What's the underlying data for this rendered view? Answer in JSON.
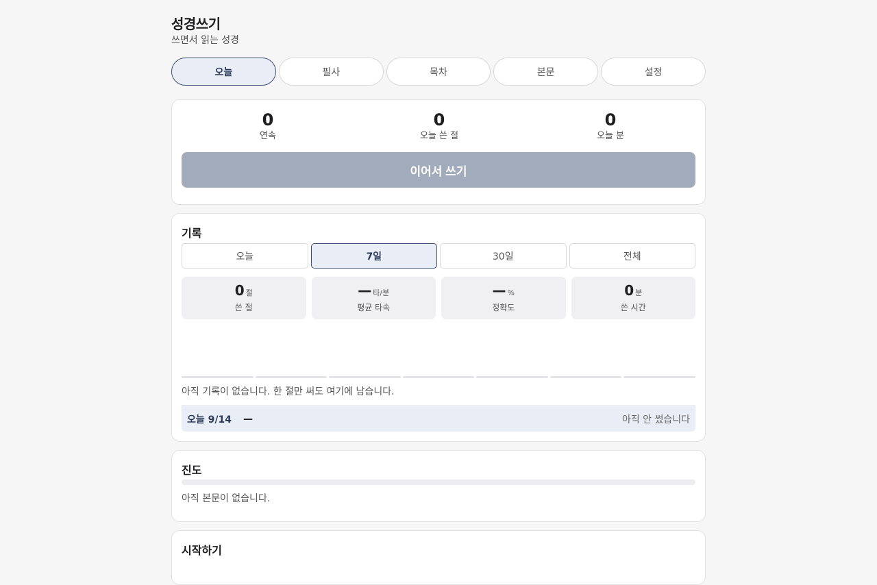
{
  "header": {
    "title": "성경쓰기",
    "subtitle": "쓰면서 읽는 성경"
  },
  "tabs": [
    {
      "label": "오늘",
      "active": true
    },
    {
      "label": "필사",
      "active": false
    },
    {
      "label": "목차",
      "active": false
    },
    {
      "label": "본문",
      "active": false
    },
    {
      "label": "설정",
      "active": false
    }
  ],
  "today": {
    "stats": [
      {
        "value": "0",
        "label": "연속"
      },
      {
        "value": "0",
        "label": "오늘 쓴 절"
      },
      {
        "value": "0",
        "label": "오늘 분"
      }
    ],
    "continue_label": "이어서 쓰기"
  },
  "history": {
    "title": "기록",
    "ranges": [
      {
        "label": "오늘",
        "active": false
      },
      {
        "label": "7일",
        "active": true
      },
      {
        "label": "30일",
        "active": false
      },
      {
        "label": "전체",
        "active": false
      }
    ],
    "metrics": [
      {
        "value": "0",
        "unit": "절",
        "label": "쓴 절"
      },
      {
        "value": "—",
        "unit": "타/분",
        "label": "평균 타속"
      },
      {
        "value": "—",
        "unit": "%",
        "label": "정확도"
      },
      {
        "value": "0",
        "unit": "분",
        "label": "쓴 시간"
      }
    ],
    "daily_values": [
      0,
      0,
      0,
      0,
      0,
      0,
      0
    ],
    "empty_message": "아직 기록이 없습니다. 한 절만 써도 여기에 남습니다.",
    "day_row": {
      "label": "오늘 9/14",
      "value": "—",
      "status": "아직 안 썼습니다"
    }
  },
  "progress": {
    "title": "진도",
    "fraction": 0,
    "empty_message": "아직 본문이 없습니다."
  },
  "start": {
    "title": "시작하기"
  }
}
